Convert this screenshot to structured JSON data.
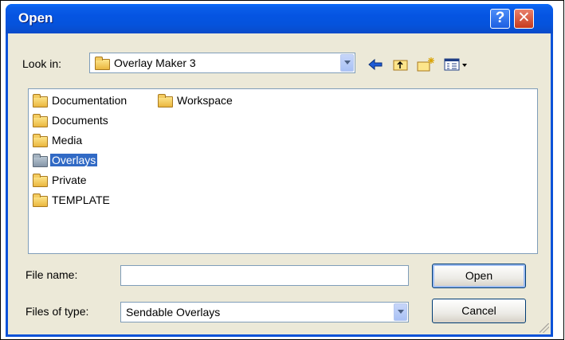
{
  "window": {
    "title": "Open"
  },
  "look_in": {
    "label": "Look in:",
    "value": "Overlay Maker 3"
  },
  "folders": [
    {
      "name": "Documentation",
      "selected": false
    },
    {
      "name": "Workspace",
      "selected": false
    },
    {
      "name": "Documents",
      "selected": false
    },
    {
      "name": "Media",
      "selected": false
    },
    {
      "name": "Overlays",
      "selected": true
    },
    {
      "name": "Private",
      "selected": false
    },
    {
      "name": "TEMPLATE",
      "selected": false
    }
  ],
  "file_name": {
    "label": "File name:",
    "value": ""
  },
  "file_type": {
    "label": "Files of type:",
    "value": "Sendable Overlays"
  },
  "buttons": {
    "open": "Open",
    "cancel": "Cancel"
  },
  "titlebar_buttons": {
    "help": "?",
    "close": "✕"
  },
  "icons": {
    "back": "back-arrow-icon",
    "up": "up-folder-icon",
    "new_folder": "new-folder-icon",
    "view": "view-menu-icon"
  },
  "colors": {
    "titlebar": "#0553dc",
    "selection": "#316ac5",
    "dialog": "#ece9d8"
  }
}
